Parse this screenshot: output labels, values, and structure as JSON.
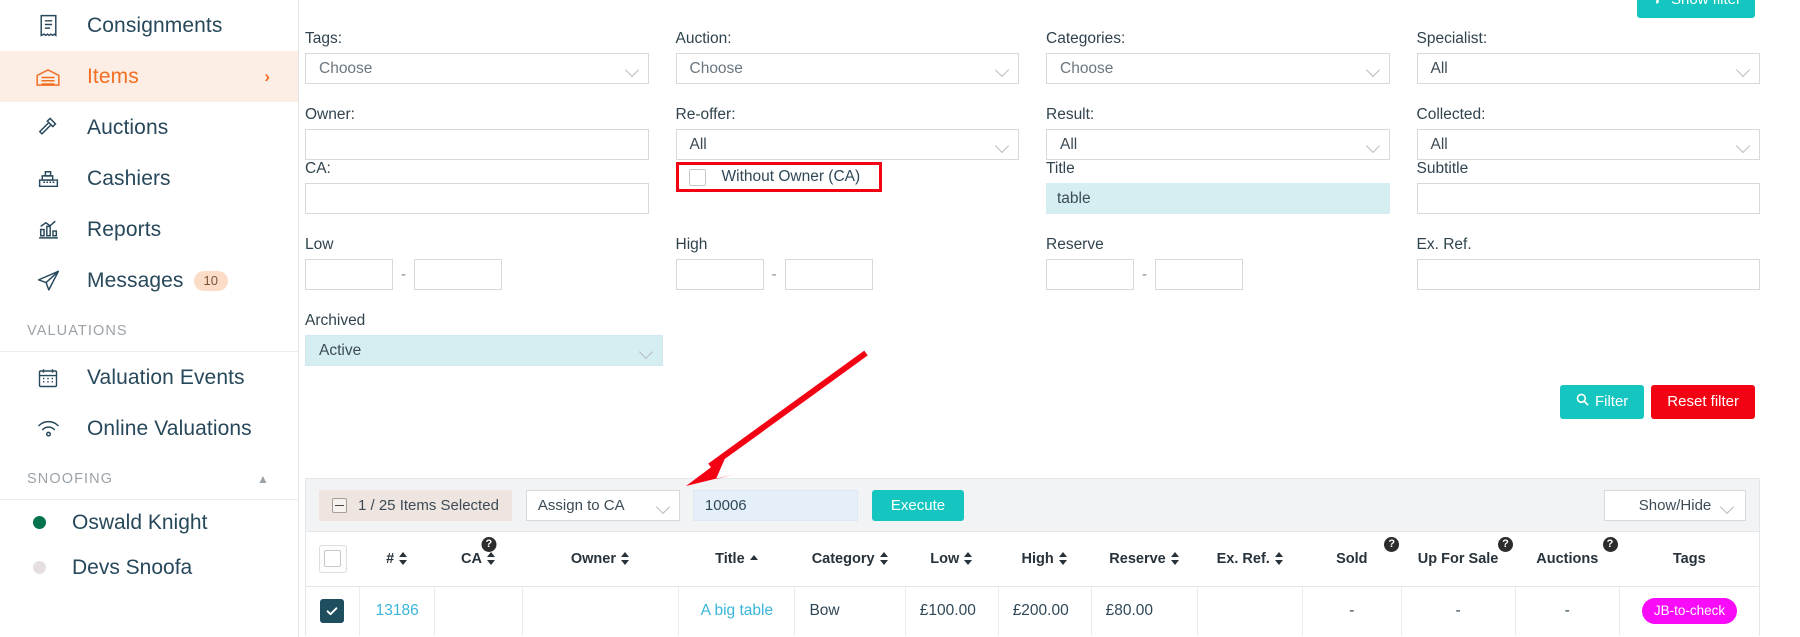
{
  "sidebar": {
    "items": [
      {
        "label": "Consignments",
        "icon": "clipboard-icon",
        "active": false
      },
      {
        "label": "Items",
        "icon": "warehouse-icon",
        "active": true
      },
      {
        "label": "Auctions",
        "icon": "gavel-icon",
        "active": false
      },
      {
        "label": "Cashiers",
        "icon": "cash-register-icon",
        "active": false
      },
      {
        "label": "Reports",
        "icon": "bar-chart-icon",
        "active": false
      },
      {
        "label": "Messages",
        "icon": "paper-plane-icon",
        "active": false,
        "badge": "10"
      }
    ],
    "sections": [
      {
        "title": "VALUATIONS"
      },
      {
        "title": "SNOOFING"
      }
    ],
    "valuation_items": [
      {
        "label": "Valuation Events",
        "icon": "calendar-icon"
      },
      {
        "label": "Online Valuations",
        "icon": "wifi-icon"
      }
    ],
    "people": [
      {
        "name": "Oswald Knight",
        "status": "online"
      },
      {
        "name": "Devs Snoofa",
        "status": "offline"
      }
    ]
  },
  "header": {
    "show_filter_label": "Show filter",
    "show_filter_icon": "funnel-icon"
  },
  "filters": {
    "tags": {
      "label": "Tags:",
      "value": "Choose"
    },
    "auction": {
      "label": "Auction:",
      "value": "Choose"
    },
    "categories": {
      "label": "Categories:",
      "value": "Choose"
    },
    "specialist": {
      "label": "Specialist:",
      "value": "All"
    },
    "owner": {
      "label": "Owner:",
      "value": ""
    },
    "reoffer": {
      "label": "Re-offer:",
      "value": "All"
    },
    "result": {
      "label": "Result:",
      "value": "All"
    },
    "collected": {
      "label": "Collected:",
      "value": "All"
    },
    "ca": {
      "label": "CA:",
      "value": ""
    },
    "without_owner": {
      "label": "Without Owner (CA)",
      "checked": false
    },
    "title": {
      "label": "Title",
      "value": "table"
    },
    "subtitle": {
      "label": "Subtitle",
      "value": ""
    },
    "low": {
      "label": "Low",
      "from": "",
      "to": "",
      "dash": "-"
    },
    "high": {
      "label": "High",
      "from": "",
      "to": "",
      "dash": "-"
    },
    "reserve": {
      "label": "Reserve",
      "from": "",
      "to": "",
      "dash": "-"
    },
    "ex_ref": {
      "label": "Ex. Ref.",
      "value": ""
    },
    "archived": {
      "label": "Archived",
      "value": "Active"
    },
    "filter_button": "Filter",
    "filter_button_icon": "search-icon",
    "reset_button": "Reset filter"
  },
  "toolbar": {
    "selected_text": "1 / 25 Items Selected",
    "bulk_action": "Assign to CA",
    "bulk_value": "10006",
    "execute_label": "Execute",
    "showhide_label": "Show/Hide"
  },
  "table": {
    "columns": [
      {
        "key": "checkbox",
        "label": "",
        "sortable": false,
        "help": false
      },
      {
        "key": "num",
        "label": "#",
        "sortable": true,
        "help": false
      },
      {
        "key": "ca",
        "label": "CA",
        "sortable": true,
        "help": true
      },
      {
        "key": "owner",
        "label": "Owner",
        "sortable": true,
        "help": false
      },
      {
        "key": "title",
        "label": "Title",
        "sortable": true,
        "sort": "asc",
        "help": false
      },
      {
        "key": "category",
        "label": "Category",
        "sortable": true,
        "help": false
      },
      {
        "key": "low",
        "label": "Low",
        "sortable": true,
        "help": false
      },
      {
        "key": "high",
        "label": "High",
        "sortable": true,
        "help": false
      },
      {
        "key": "reserve",
        "label": "Reserve",
        "sortable": true,
        "help": false
      },
      {
        "key": "exref",
        "label": "Ex. Ref.",
        "sortable": true,
        "help": false
      },
      {
        "key": "sold",
        "label": "Sold",
        "sortable": false,
        "help": true
      },
      {
        "key": "upforsale",
        "label": "Up For Sale",
        "sortable": false,
        "help": true
      },
      {
        "key": "auctions",
        "label": "Auctions",
        "sortable": false,
        "help": true
      },
      {
        "key": "tags",
        "label": "Tags",
        "sortable": false,
        "help": false
      }
    ],
    "rows": [
      {
        "checked": true,
        "num": "13186",
        "ca": "",
        "owner": "",
        "title": "A big table",
        "category": "Bow",
        "low": "£100.00",
        "high": "£200.00",
        "reserve": "£80.00",
        "exref": "",
        "sold": "-",
        "upforsale": "-",
        "auctions": "-",
        "tags": "JB-to-check"
      }
    ]
  },
  "colors": {
    "accent_teal": "#15c5c0",
    "accent_orange": "#f26f21",
    "danger_red": "#f30213",
    "link_blue": "#38b6d9",
    "tag_magenta": "#f90af9",
    "highlight_cyan": "#d4eef2",
    "annotation_red": "#f30213"
  }
}
